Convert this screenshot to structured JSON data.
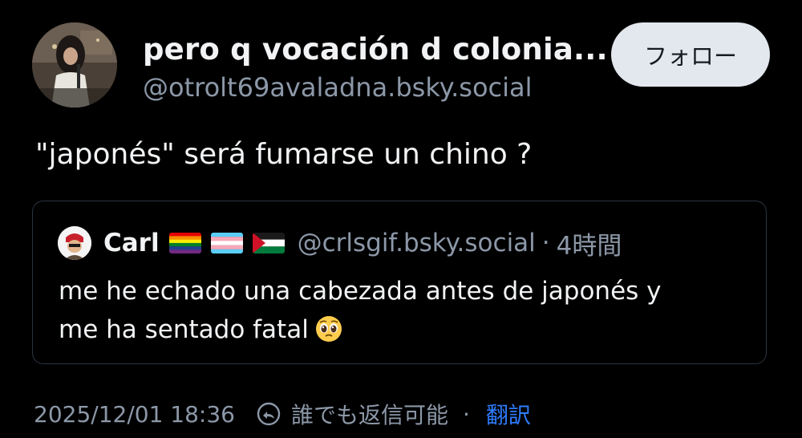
{
  "post": {
    "author": {
      "display_name": "pero q vocación d colonia...",
      "handle": "@otrolt69avaladna.bsky.social"
    },
    "follow_label": "フォロー",
    "text": "\"japonés\" será fumarse un chino ?",
    "quote": {
      "author_name": "Carl",
      "flags": [
        "rainbow-pride-flag",
        "transgender-flag",
        "palestine-flag"
      ],
      "handle": "@crlsgif.bsky.social",
      "separator": "·",
      "time": "4時間",
      "text_line1": "me he echado una cabezada antes de japonés y",
      "text_line2": "me ha sentado fatal",
      "emoji": "pleading-face-emoji"
    },
    "footer": {
      "timestamp": "2025/12/01 18:36",
      "reply_setting": "誰でも返信可能",
      "separator": "·",
      "translate_label": "翻訳"
    }
  },
  "colors": {
    "background": "#000000",
    "text_primary": "#f1f3f5",
    "text_secondary": "#8c98a8",
    "follow_button_bg": "#e3e8ee",
    "link": "#2f7dff",
    "card_border": "#2c3440"
  }
}
